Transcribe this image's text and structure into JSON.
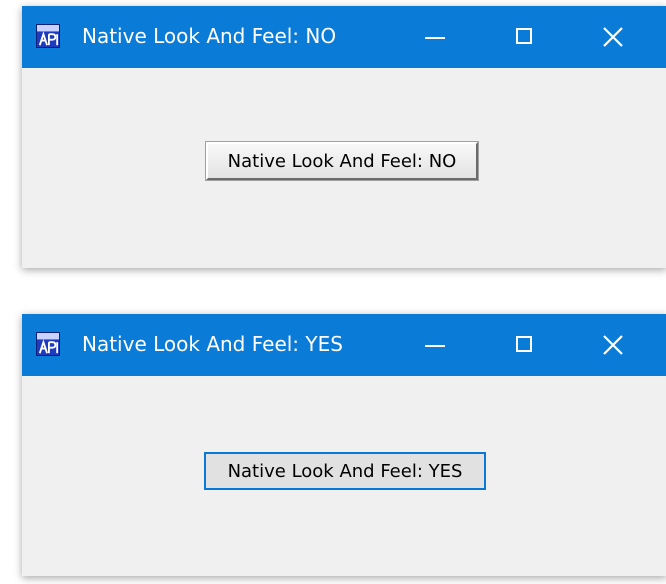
{
  "windows": [
    {
      "title": "Native Look And Feel: NO",
      "button_label": "Native Look And Feel: NO",
      "icon": "java-app-icon",
      "controls": [
        "minimize-icon",
        "maximize-icon",
        "close-icon"
      ]
    },
    {
      "title": "Native Look And Feel: YES",
      "button_label": "Native Look And Feel: YES",
      "icon": "java-app-icon",
      "controls": [
        "minimize-icon",
        "maximize-icon",
        "close-icon"
      ]
    }
  ],
  "colors": {
    "titlebar": "#0a7bd7",
    "window_bg": "#f0f0f0",
    "native_button_border": "#0a78d7"
  }
}
